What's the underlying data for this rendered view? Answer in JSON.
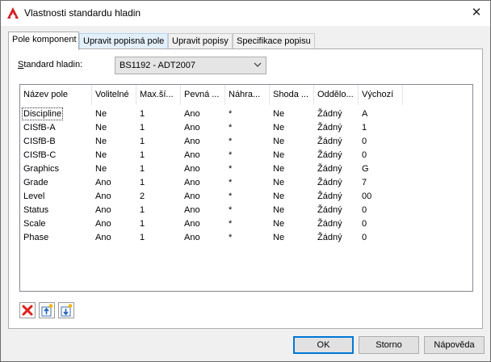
{
  "window": {
    "title": "Vlastnosti standardu hladin",
    "close_glyph": "✕"
  },
  "tabs": [
    {
      "label": "Pole komponent"
    },
    {
      "label": "Upravit popisná pole"
    },
    {
      "label": "Upravit popisy"
    },
    {
      "label": "Specifikace popisu"
    }
  ],
  "standard": {
    "label_prefix": "S",
    "label_rest": "tandard hladin:",
    "value": "BS1192 - ADT2007"
  },
  "columns": [
    "Název pole",
    "Volitelné",
    "Max.ší...",
    "Pevná ...",
    "Náhra...",
    "Shoda ...",
    "Oddělo...",
    "Výchozí"
  ],
  "rows": [
    [
      "Discipline",
      "Ne",
      "1",
      "Ano",
      "*",
      "Ne",
      "Žádný",
      "A"
    ],
    [
      "CISfB-A",
      "Ne",
      "1",
      "Ano",
      "*",
      "Ne",
      "Žádný",
      "1"
    ],
    [
      "CISfB-B",
      "Ne",
      "1",
      "Ano",
      "*",
      "Ne",
      "Žádný",
      "0"
    ],
    [
      "CISfB-C",
      "Ne",
      "1",
      "Ano",
      "*",
      "Ne",
      "Žádný",
      "0"
    ],
    [
      "Graphics",
      "Ne",
      "1",
      "Ano",
      "*",
      "Ne",
      "Žádný",
      "G"
    ],
    [
      "Grade",
      "Ano",
      "1",
      "Ano",
      "*",
      "Ne",
      "Žádný",
      "7"
    ],
    [
      "Level",
      "Ano",
      "2",
      "Ano",
      "*",
      "Ne",
      "Žádný",
      "00"
    ],
    [
      "Status",
      "Ano",
      "1",
      "Ano",
      "*",
      "Ne",
      "Žádný",
      "0"
    ],
    [
      "Scale",
      "Ano",
      "1",
      "Ano",
      "*",
      "Ne",
      "Žádný",
      "0"
    ],
    [
      "Phase",
      "Ano",
      "1",
      "Ano",
      "*",
      "Ne",
      "Žádný",
      "0"
    ]
  ],
  "toolbar": {
    "delete_icon": "delete-icon",
    "move_up_icon": "move-up-icon",
    "move_down_icon": "move-down-icon"
  },
  "buttons": {
    "ok": "OK",
    "cancel": "Storno",
    "help": "Nápověda"
  },
  "colors": {
    "accent": "#0078d7",
    "delete_red": "#e0201b",
    "brand_red": "#d42027"
  }
}
